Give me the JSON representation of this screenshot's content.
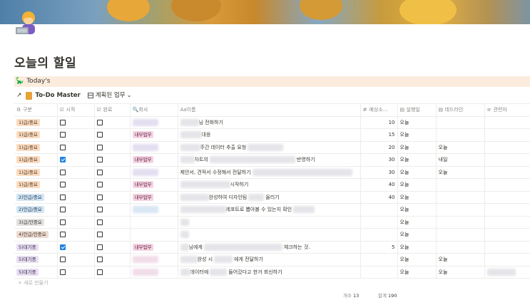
{
  "page": {
    "title": "오늘의 할일",
    "callout": "Today's",
    "callout_icon": "dinosaur-icon"
  },
  "database": {
    "link_arrow": "↗",
    "title": "To-Do Master",
    "view_name": "계획된 업무",
    "view_chevron": "⌄",
    "columns": [
      "구분",
      "시작",
      "완료",
      "회사",
      "이름",
      "예상소...",
      "실행일",
      "데드라인",
      "관련자"
    ],
    "column_icons": [
      "⚙",
      "☑",
      "☑",
      "🔍",
      "Aa",
      "#",
      "▤",
      "▤",
      "≡"
    ],
    "rows": [
      {
        "cat": "1)급/중요",
        "cls": "t1",
        "start": false,
        "done": false,
        "company_tag": "",
        "company_blur": "purple",
        "name_pre_blur": 26,
        "name": "님 전화하기",
        "name_post_blur": 0,
        "est": "10",
        "exec": "오늘",
        "deadline": "",
        "assignee": false
      },
      {
        "cat": "1)급/중요",
        "cls": "t1",
        "start": false,
        "done": false,
        "company_tag": "내부업무",
        "company_blur": "",
        "name_pre_blur": 30,
        "name": "대응",
        "name_post_blur": 0,
        "est": "15",
        "exec": "오늘",
        "deadline": "",
        "assignee": false
      },
      {
        "cat": "1)급/중요",
        "cls": "t1",
        "start": false,
        "done": false,
        "company_tag": "",
        "company_blur": "purple",
        "name_pre_blur": 28,
        "name": "주간 데이터 추출 요청",
        "name_post_blur": 50,
        "est": "20",
        "exec": "오늘",
        "deadline": "오늘",
        "assignee": false
      },
      {
        "cat": "1)급/중요",
        "cls": "t1",
        "start": true,
        "done": false,
        "company_tag": "내부업무",
        "company_blur": "",
        "name_pre_blur": 20,
        "name": "차트의",
        "name_post_blur": 120,
        "name_tail": "반영하기",
        "est": "30",
        "exec": "오늘",
        "deadline": "내일",
        "assignee": false
      },
      {
        "cat": "1)급/중요",
        "cls": "t1",
        "start": false,
        "done": false,
        "company_tag": "",
        "company_blur": "purple",
        "name_pre_blur": 0,
        "name": "제안서, 견적서 수정해서 전달하기",
        "name_post_blur": 140,
        "est": "30",
        "exec": "오늘",
        "deadline": "오늘",
        "assignee": false
      },
      {
        "cat": "1)급/중요",
        "cls": "t1",
        "start": false,
        "done": false,
        "company_tag": "내부업무",
        "company_blur": "",
        "name_pre_blur": 70,
        "name": "시작하기",
        "name_post_blur": 0,
        "est": "40",
        "exec": "오늘",
        "deadline": "",
        "assignee": false
      },
      {
        "cat": "2)안급/중요",
        "cls": "t2",
        "start": false,
        "done": false,
        "company_tag": "내부업무",
        "company_blur": "",
        "name_pre_blur": 40,
        "name": "완성하여 디자인팀",
        "name_post_blur": 22,
        "name_tail": "올리기",
        "est": "40",
        "exec": "오늘",
        "deadline": "",
        "assignee": false
      },
      {
        "cat": "2)안급/중요",
        "cls": "t2",
        "start": false,
        "done": false,
        "company_tag": "",
        "company_blur": "blue",
        "name_pre_blur": 64,
        "name": "레포트로 뽑아볼 수 있는지 확인",
        "name_post_blur": 30,
        "est": "",
        "exec": "오늘",
        "deadline": "",
        "assignee": false
      },
      {
        "cat": "3)급/안중요",
        "cls": "t3",
        "start": false,
        "done": false,
        "company_tag": "",
        "company_blur": "",
        "name_pre_blur": 12,
        "name": "",
        "name_post_blur": 0,
        "est": "",
        "exec": "오늘",
        "deadline": "",
        "assignee": false
      },
      {
        "cat": "4)안급/안중요",
        "cls": "t4",
        "start": false,
        "done": false,
        "company_tag": "",
        "company_blur": "",
        "name_pre_blur": 12,
        "name": "",
        "name_post_blur": 0,
        "est": "",
        "exec": "오늘",
        "deadline": "",
        "assignee": false
      },
      {
        "cat": "5)대기중",
        "cls": "t5",
        "start": true,
        "done": false,
        "company_tag": "내부업무",
        "company_blur": "",
        "name_pre_blur": 12,
        "name": "님에게",
        "name_post_blur": 110,
        "name_tail": "체크하는 것.",
        "est": "5",
        "exec": "오늘",
        "deadline": "",
        "assignee": false
      },
      {
        "cat": "5)대기중",
        "cls": "t5",
        "start": false,
        "done": false,
        "company_tag": "",
        "company_blur": "pinkish",
        "name_pre_blur": 24,
        "name": "완성 시",
        "name_post_blur": 26,
        "name_tail": "에게 전달하기",
        "est": "",
        "exec": "오늘",
        "deadline": "오늘",
        "assignee": false
      },
      {
        "cat": "5)대기중",
        "cls": "t5",
        "start": false,
        "done": false,
        "company_tag": "",
        "company_blur": "pinkish",
        "name_pre_blur": 14,
        "name": "데이터에",
        "name_post_blur": 24,
        "name_tail": "들어갔다고 한거 회신하기",
        "est": "",
        "exec": "오늘",
        "deadline": "오늘",
        "assignee": true
      }
    ],
    "new_row_label": "+ 새로 만들기",
    "summary": {
      "count_label": "개수",
      "count": "13",
      "sum_label": "합계",
      "sum": "190"
    }
  },
  "colors": {
    "checkbox_on": "#2383e2",
    "callout_bg": "#fbecdd",
    "work_tag": "#f5d3e2"
  }
}
